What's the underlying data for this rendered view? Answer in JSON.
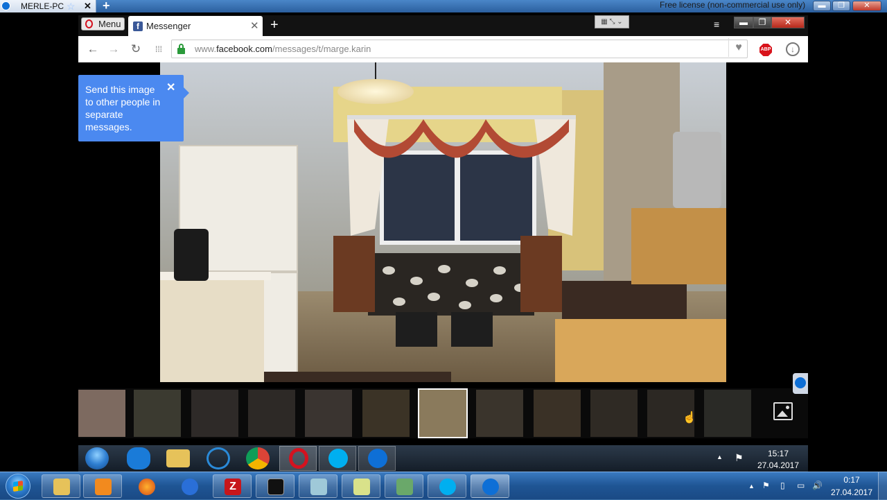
{
  "outer": {
    "remote_tab_label": "MERLE-PC",
    "close_glyph": "✕",
    "plus_glyph": "+",
    "star_glyph": "☆",
    "license_text": "Free license (non-commercial use only)",
    "min_glyph": "▬",
    "max_glyph": "❐",
    "close_btn_glyph": "✕"
  },
  "browser": {
    "menu_label": "Menu",
    "tab_title": "Messenger",
    "tab_close": "✕",
    "new_tab": "+",
    "tab_grid_label": "▦ ⤡ ⌄",
    "tab_menu_glyph": "≡",
    "window_min": "▬",
    "window_max": "❐",
    "window_close": "✕",
    "nav": {
      "back": "←",
      "forward": "→",
      "reload": "↻",
      "speed_dial": "⁞⁞⁞"
    },
    "url_prefix": "www.",
    "url_domain": "facebook.com",
    "url_path": "/messages/t/marge.karin",
    "bookmark_glyph": "♥",
    "abp_label": "ABP",
    "download_glyph": "↓"
  },
  "tooltip": {
    "text": "Send this image to other people in separate messages.",
    "close": "✕"
  },
  "remote_taskbar": {
    "time": "15:17",
    "date": "27.04.2017",
    "tray_arrow": "▲",
    "flag_glyph": "⚑"
  },
  "local_taskbar": {
    "time": "0:17",
    "date": "27.04.2017",
    "tray_arrow": "▲",
    "tray_flag": "⚑",
    "tray_battery": "▯",
    "tray_network": "▭",
    "tray_volume": "🔊"
  },
  "colors": {
    "messenger_blue": "#4b89f0",
    "opera_red": "#d4121f",
    "facebook_blue": "#3b5998",
    "secure_green": "#2a9a3a"
  },
  "icons": {
    "thumbnail_count_note": "",
    "cursor_glyph": "☝"
  }
}
